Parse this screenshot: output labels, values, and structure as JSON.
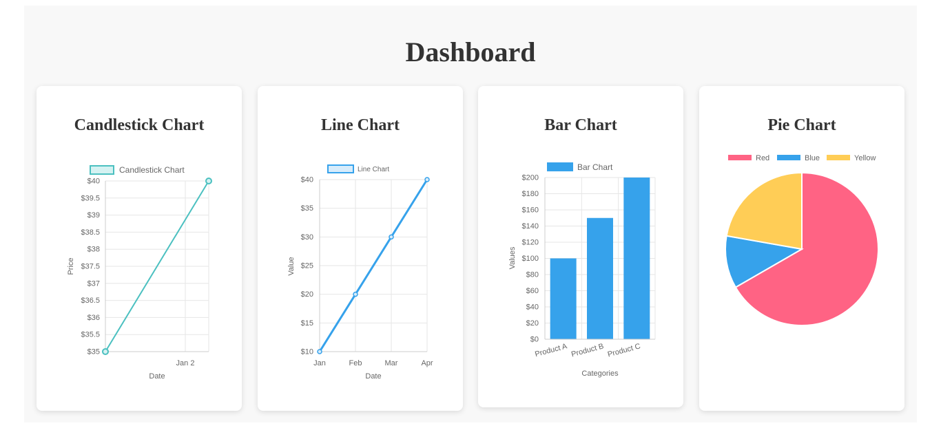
{
  "page": {
    "title": "Dashboard"
  },
  "chart_data": [
    {
      "type": "line",
      "card_title": "Candlestick Chart",
      "legend": {
        "label": "Candlestick Chart",
        "position": "top"
      },
      "xlabel": "Date",
      "ylabel": "Price",
      "x_ticks": [
        "Jan 2"
      ],
      "y_ticks": [
        "$35",
        "$35.5",
        "$36",
        "$36.5",
        "$37",
        "$37.5",
        "$38",
        "$38.5",
        "$39",
        "$39.5",
        "$40"
      ],
      "ylim": [
        35,
        40
      ],
      "grid": true,
      "series": [
        {
          "name": "Candlestick Chart",
          "points": [
            {
              "x": "Jan 1",
              "y": 35
            },
            {
              "x": "Jan 2",
              "y": 40
            }
          ]
        }
      ],
      "colors": {
        "line": "#4bc0c0",
        "fill": "#d5f2f2"
      }
    },
    {
      "type": "line",
      "card_title": "Line Chart",
      "legend": {
        "label": "Line Chart",
        "position": "top"
      },
      "xlabel": "Date",
      "ylabel": "Value",
      "categories": [
        "Jan",
        "Feb",
        "Mar",
        "Apr"
      ],
      "y_ticks": [
        "$10",
        "$15",
        "$20",
        "$25",
        "$30",
        "$35",
        "$40"
      ],
      "ylim": [
        10,
        40
      ],
      "grid": true,
      "series": [
        {
          "name": "Line Chart",
          "values": [
            10,
            20,
            30,
            40
          ]
        }
      ],
      "colors": {
        "line": "#36a2eb",
        "fill": "#d7ecfb"
      }
    },
    {
      "type": "bar",
      "card_title": "Bar Chart",
      "legend": {
        "label": "Bar Chart",
        "position": "top"
      },
      "xlabel": "Categories",
      "ylabel": "Values",
      "categories": [
        "Product A",
        "Product B",
        "Product C"
      ],
      "y_ticks": [
        "$0",
        "$20",
        "$40",
        "$60",
        "$80",
        "$100",
        "$120",
        "$140",
        "$160",
        "$180",
        "$200"
      ],
      "ylim": [
        0,
        200
      ],
      "grid": true,
      "series": [
        {
          "name": "Bar Chart",
          "values": [
            100,
            150,
            200
          ]
        }
      ],
      "colors": {
        "bar": "#36a2eb"
      }
    },
    {
      "type": "pie",
      "card_title": "Pie Chart",
      "legend": {
        "position": "top"
      },
      "labels": [
        "Red",
        "Blue",
        "Yellow"
      ],
      "values": [
        300,
        50,
        100
      ],
      "colors": [
        "#ff6384",
        "#36a2eb",
        "#ffcd56"
      ]
    }
  ]
}
